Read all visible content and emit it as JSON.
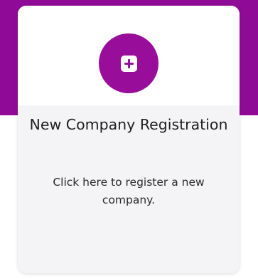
{
  "card": {
    "title": "New Company Registration",
    "description": "Click here to register a new company.",
    "icon": "plus-square-icon"
  },
  "colors": {
    "accent": "#980d99",
    "band": "#8f0b97",
    "card_background": "#f4f4f6"
  }
}
